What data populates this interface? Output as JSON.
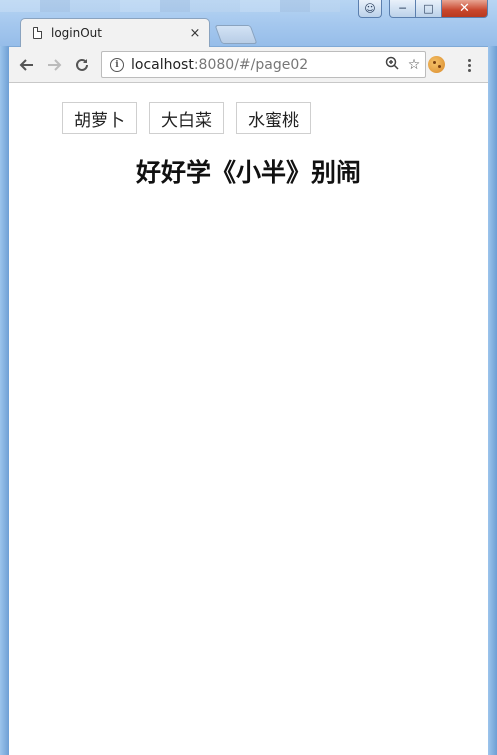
{
  "browser": {
    "tab_title": "loginOut",
    "tab_close": "×",
    "url_host": "localhost",
    "url_rest": ":8080/#/page02"
  },
  "page": {
    "nav_buttons": [
      "胡萝卜",
      "大白菜",
      "水蜜桃"
    ],
    "heading": "好好学《小半》别闹"
  },
  "colors": {
    "window_frame": "#7fa9d6",
    "close_button": "#c8462d",
    "page_background": "#ffffff"
  }
}
